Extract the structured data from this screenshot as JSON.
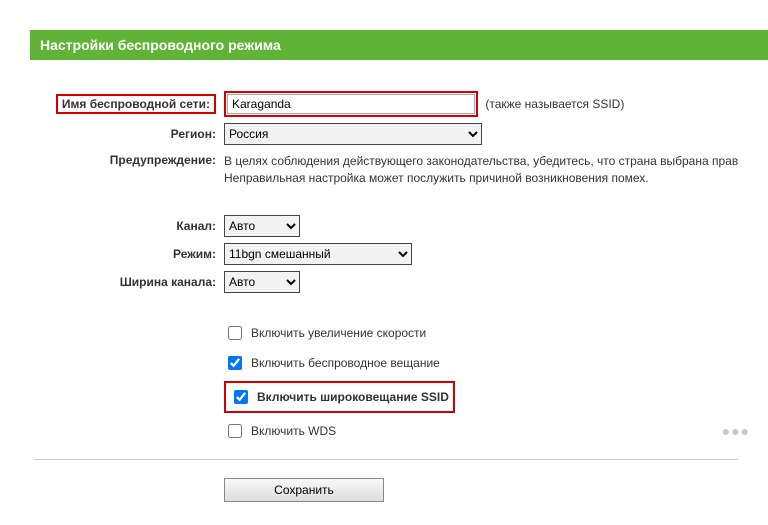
{
  "header": {
    "title": "Настройки беспроводного режима"
  },
  "labels": {
    "ssid": "Имя беспроводной сети:",
    "region": "Регион:",
    "warning": "Предупреждение:",
    "channel": "Канал:",
    "mode": "Режим:",
    "width": "Ширина канала:"
  },
  "values": {
    "ssid": "Karaganda",
    "region": "Россия",
    "channel": "Авто",
    "mode": "11bgn смешанный",
    "width": "Авто"
  },
  "hints": {
    "ssid_note": "(также называется SSID)",
    "warning_line1": "В целях соблюдения действующего законодательства, убедитесь, что страна выбрана прав",
    "warning_line2": "Неправильная настройка может послужить причиной возникновения помех."
  },
  "checkboxes": {
    "speed_boost": {
      "label": "Включить увеличение скорости",
      "checked": false
    },
    "wireless_broadcast": {
      "label": "Включить беспроводное вещание",
      "checked": true
    },
    "ssid_broadcast": {
      "label": "Включить широковещание SSID",
      "checked": true
    },
    "wds": {
      "label": "Включить WDS",
      "checked": false
    }
  },
  "buttons": {
    "save": "Сохранить"
  },
  "options": {
    "region": [
      "Россия"
    ],
    "channel": [
      "Авто"
    ],
    "mode": [
      "11bgn смешанный"
    ],
    "width": [
      "Авто"
    ]
  }
}
